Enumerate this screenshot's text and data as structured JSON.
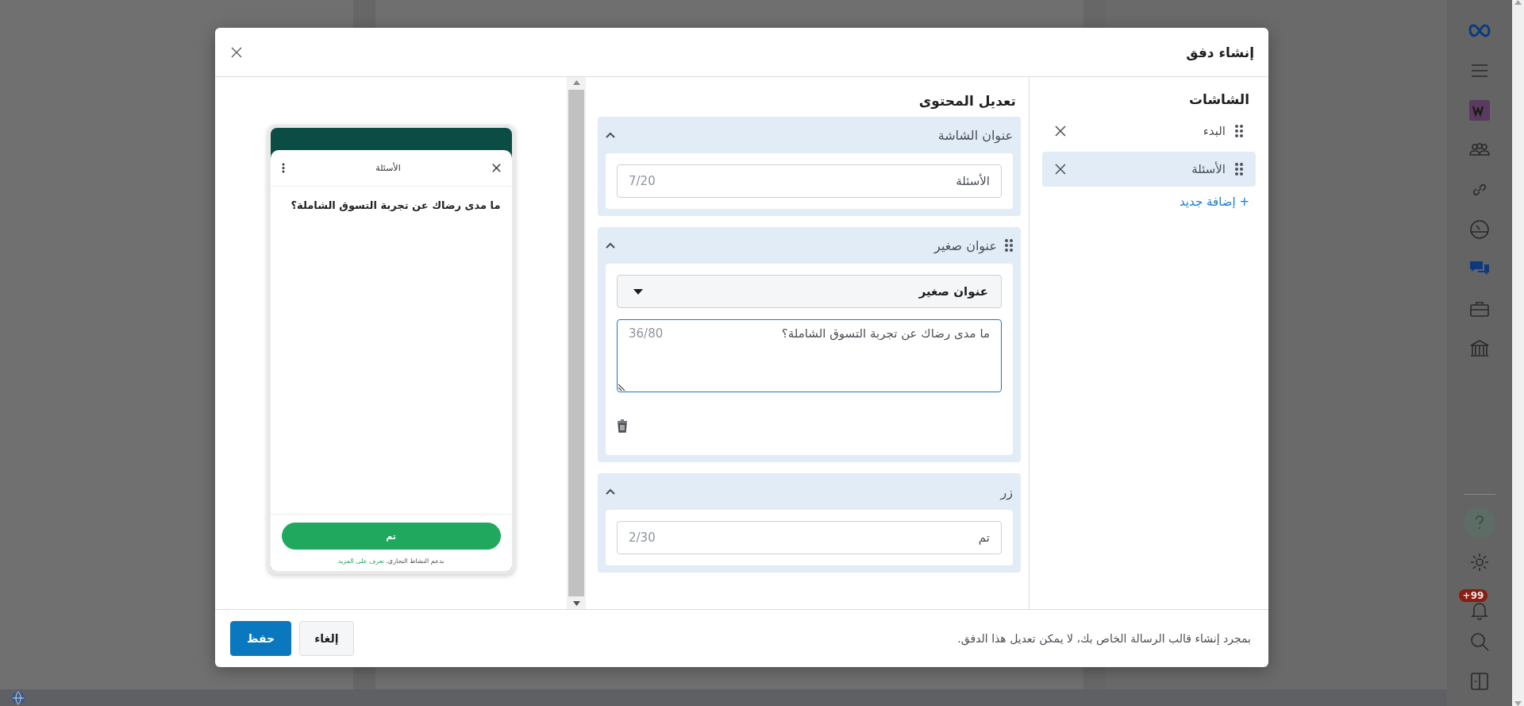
{
  "sidebar": {
    "notification_badge": "+99"
  },
  "dialog": {
    "title": "إنشاء دفق"
  },
  "screens": {
    "title": "الشاشات",
    "items": [
      {
        "label": "البدء",
        "selected": false
      },
      {
        "label": "الأسئلة",
        "selected": true
      }
    ],
    "add_link": "+ إضافة جديد"
  },
  "editor": {
    "title": "تعديل المحتوى",
    "sections": [
      {
        "kind": "text_field",
        "title": "عنوان الشاشة",
        "expanded": true,
        "draggable": false,
        "value": "الأسئلة",
        "counter": "7/20"
      },
      {
        "kind": "subtitle",
        "title": "عنوان صغير",
        "expanded": true,
        "draggable": true,
        "dropdown": "عنوان صغير",
        "value": "ما مدى رضاك عن تجربة التسوق الشاملة؟",
        "counter": "36/80",
        "focused": true
      },
      {
        "kind": "text_field",
        "title": "زر",
        "expanded": true,
        "draggable": false,
        "value": "تم",
        "counter": "2/30"
      }
    ]
  },
  "preview": {
    "header_title": "الأسئلة",
    "question": "ما مدى رضاك عن تجربة التسوق الشاملة؟",
    "button": "تم",
    "footer_text": "بدعم النشاط التجاري.",
    "footer_link": "تعرف على المزيد"
  },
  "footer": {
    "note": "بمجرد إنشاء قالب الرسالة الخاص بك، لا يمكن تعديل هذا الدفق.",
    "buttons": [
      {
        "label": "إلغاء",
        "kind": "secondary"
      },
      {
        "label": "حفظ",
        "kind": "primary"
      }
    ]
  }
}
